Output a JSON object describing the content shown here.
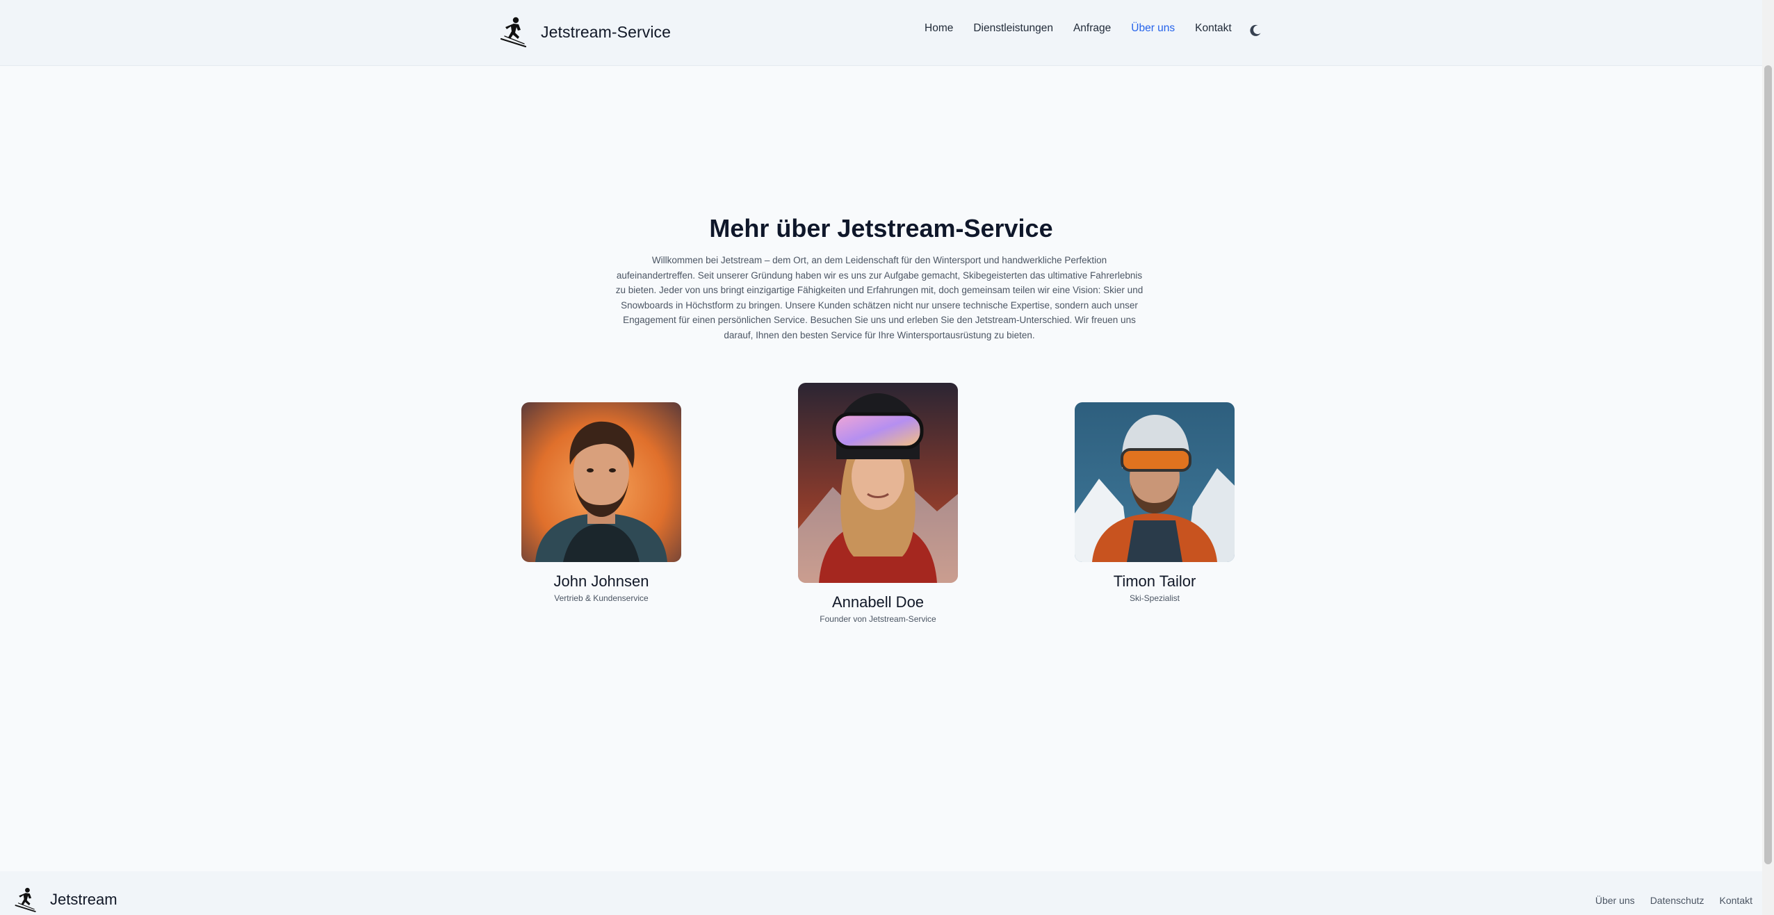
{
  "header": {
    "brand": "Jetstream-Service",
    "nav": [
      {
        "label": "Home"
      },
      {
        "label": "Dienstleistungen"
      },
      {
        "label": "Anfrage"
      },
      {
        "label": "Über uns",
        "active": true
      },
      {
        "label": "Kontakt"
      }
    ],
    "theme_icon": "moon-icon"
  },
  "main": {
    "title": "Mehr über Jetstream-Service",
    "intro": "Willkommen bei Jetstream – dem Ort, an dem Leidenschaft für den Wintersport und handwerkliche Perfektion aufeinandertreffen. Seit unserer Gründung haben wir es uns zur Aufgabe gemacht, Skibegeisterten das ultimative Fahrerlebnis zu bieten. Jeder von uns bringt einzigartige Fähigkeiten und Erfahrungen mit, doch gemeinsam teilen wir eine Vision: Skier und Snowboards in Höchstform zu bringen. Unsere Kunden schätzen nicht nur unsere technische Expertise, sondern auch unser Engagement für einen persönlichen Service. Besuchen Sie uns und erleben Sie den Jetstream-Unterschied. Wir freuen uns darauf, Ihnen den besten Service für Ihre Wintersportausrüstung zu bieten.",
    "team": [
      {
        "name": "John Johnsen",
        "role": "Vertrieb & Kundenservice"
      },
      {
        "name": "Annabell Doe",
        "role": "Founder von Jetstream-Service"
      },
      {
        "name": "Timon Tailor",
        "role": "Ski-Spezialist"
      }
    ]
  },
  "footer": {
    "brand": "Jetstream",
    "links": [
      "Über uns",
      "Datenschutz",
      "Kontakt"
    ]
  },
  "colors": {
    "accent": "#2563eb",
    "background": "#f8fafc",
    "header_bg": "#f1f5f9"
  }
}
